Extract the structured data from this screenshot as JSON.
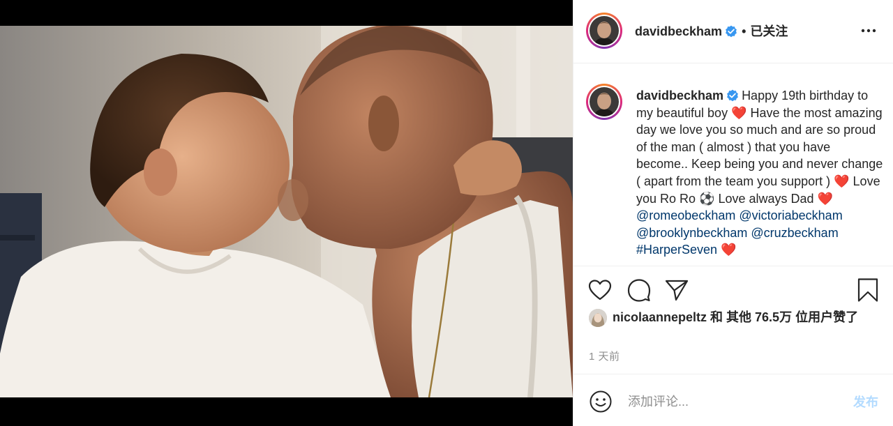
{
  "post": {
    "username": "davidbeckham",
    "follow_status": "已关注",
    "separator": "•",
    "caption_segments": [
      {
        "text": "Happy 19th birthday to my beautiful boy ",
        "kind": "text"
      },
      {
        "text": "❤️",
        "kind": "heart"
      },
      {
        "text": " Have the most amazing day we love you so much and are so proud of the man ( almost ) that you have become.. Keep being you and never change ( apart from the team you support ) ",
        "kind": "text"
      },
      {
        "text": "❤️",
        "kind": "heart"
      },
      {
        "text": " Love you Ro Ro ",
        "kind": "text"
      },
      {
        "text": "⚽",
        "kind": "text"
      },
      {
        "text": " Love always Dad ",
        "kind": "text"
      },
      {
        "text": "❤️",
        "kind": "heart"
      },
      {
        "text": "@romeobeckham",
        "kind": "link"
      },
      {
        "text": " ",
        "kind": "text"
      },
      {
        "text": "@victoriabeckham",
        "kind": "link"
      },
      {
        "text": " ",
        "kind": "text"
      },
      {
        "text": "@brooklynbeckham",
        "kind": "link"
      },
      {
        "text": " ",
        "kind": "text"
      },
      {
        "text": "@cruzbeckham",
        "kind": "link"
      },
      {
        "text": " ",
        "kind": "text"
      },
      {
        "text": "#HarperSeven",
        "kind": "link"
      },
      {
        "text": " ",
        "kind": "text"
      },
      {
        "text": "❤️",
        "kind": "heart"
      }
    ],
    "likes": {
      "user": "nicolaannepeltz",
      "text": " 和 其他 76.5万 位用户赞了"
    },
    "time": "1 天前"
  },
  "comment": {
    "placeholder": "添加评论...",
    "post_label": "发布"
  },
  "icons": {
    "more": "more-horizontal-icon",
    "like": "heart-outline-icon",
    "comment": "comment-bubble-icon",
    "share": "paper-plane-icon",
    "save": "bookmark-icon",
    "emoji": "smiley-icon",
    "verified": "verified-badge-icon"
  },
  "colors": {
    "verified": "#3897f0",
    "link": "#00376b",
    "heart": "#e0245e",
    "post_button_disabled": "#b3dbff",
    "muted": "#8e8e8e"
  }
}
